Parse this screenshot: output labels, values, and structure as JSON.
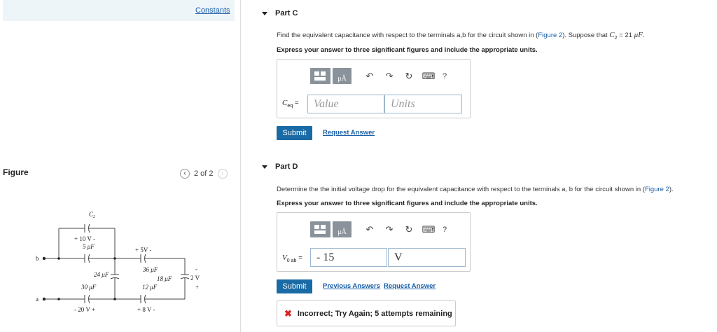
{
  "left": {
    "constants_label": "Constants",
    "figure_label": "Figure",
    "pager_text": "2 of 2"
  },
  "circuit": {
    "c2": "C",
    "c2_sub": "2",
    "v10": "+ 10 V -",
    "c5": "5 μF",
    "v5": "+ 5V -",
    "c24": "24 μF",
    "c36": "36 μF",
    "c18": "18 μF",
    "v2": "2 V",
    "c30": "30 μF",
    "c12": "12 μF",
    "v20": "- 20 V +",
    "v8": "+ 8 V -",
    "node_b": "b",
    "node_a": "a",
    "minus": "-",
    "plus": "+"
  },
  "partC": {
    "title": "Part C",
    "question_pre": "Find the equivalent capacitance with respect to the terminals a,b for the circuit shown in (",
    "question_link": "Figure 2",
    "question_post": "). Suppose that",
    "given_sym": "C",
    "given_sub": "2",
    "given_val": "= 21",
    "given_unit": "μF",
    "given_end": ".",
    "instruction": "Express your answer to three significant figures and include the appropriate units.",
    "label_main": "C",
    "label_sub": "eq",
    "label_eq": "=",
    "value_placeholder": "Value",
    "units_placeholder": "Units",
    "submit": "Submit",
    "request": "Request Answer"
  },
  "partD": {
    "title": "Part D",
    "question_pre": "Determine the the initial voltage drop for the equivalent capacitance with respect to the terminals a, b for the circuit shown in (",
    "question_link": "Figure 2",
    "question_post": ").",
    "instruction": "Express your answer to three significant figures and include the appropriate units.",
    "label_main": "V",
    "label_sub": "0 ab",
    "label_eq": "=",
    "value": "- 15",
    "units": "V",
    "submit": "Submit",
    "previous": "Previous Answers",
    "request": "Request Answer",
    "feedback": "Incorrect; Try Again; 5 attempts remaining"
  },
  "toolbar": {
    "mu_label": "μÅ",
    "help": "?"
  },
  "icons": [
    "templates-icon",
    "units-icon",
    "undo-icon",
    "redo-icon",
    "reset-icon",
    "keyboard-icon",
    "help-icon",
    "incorrect-icon",
    "chevron-left-icon",
    "chevron-right-icon",
    "caret-down-icon"
  ]
}
